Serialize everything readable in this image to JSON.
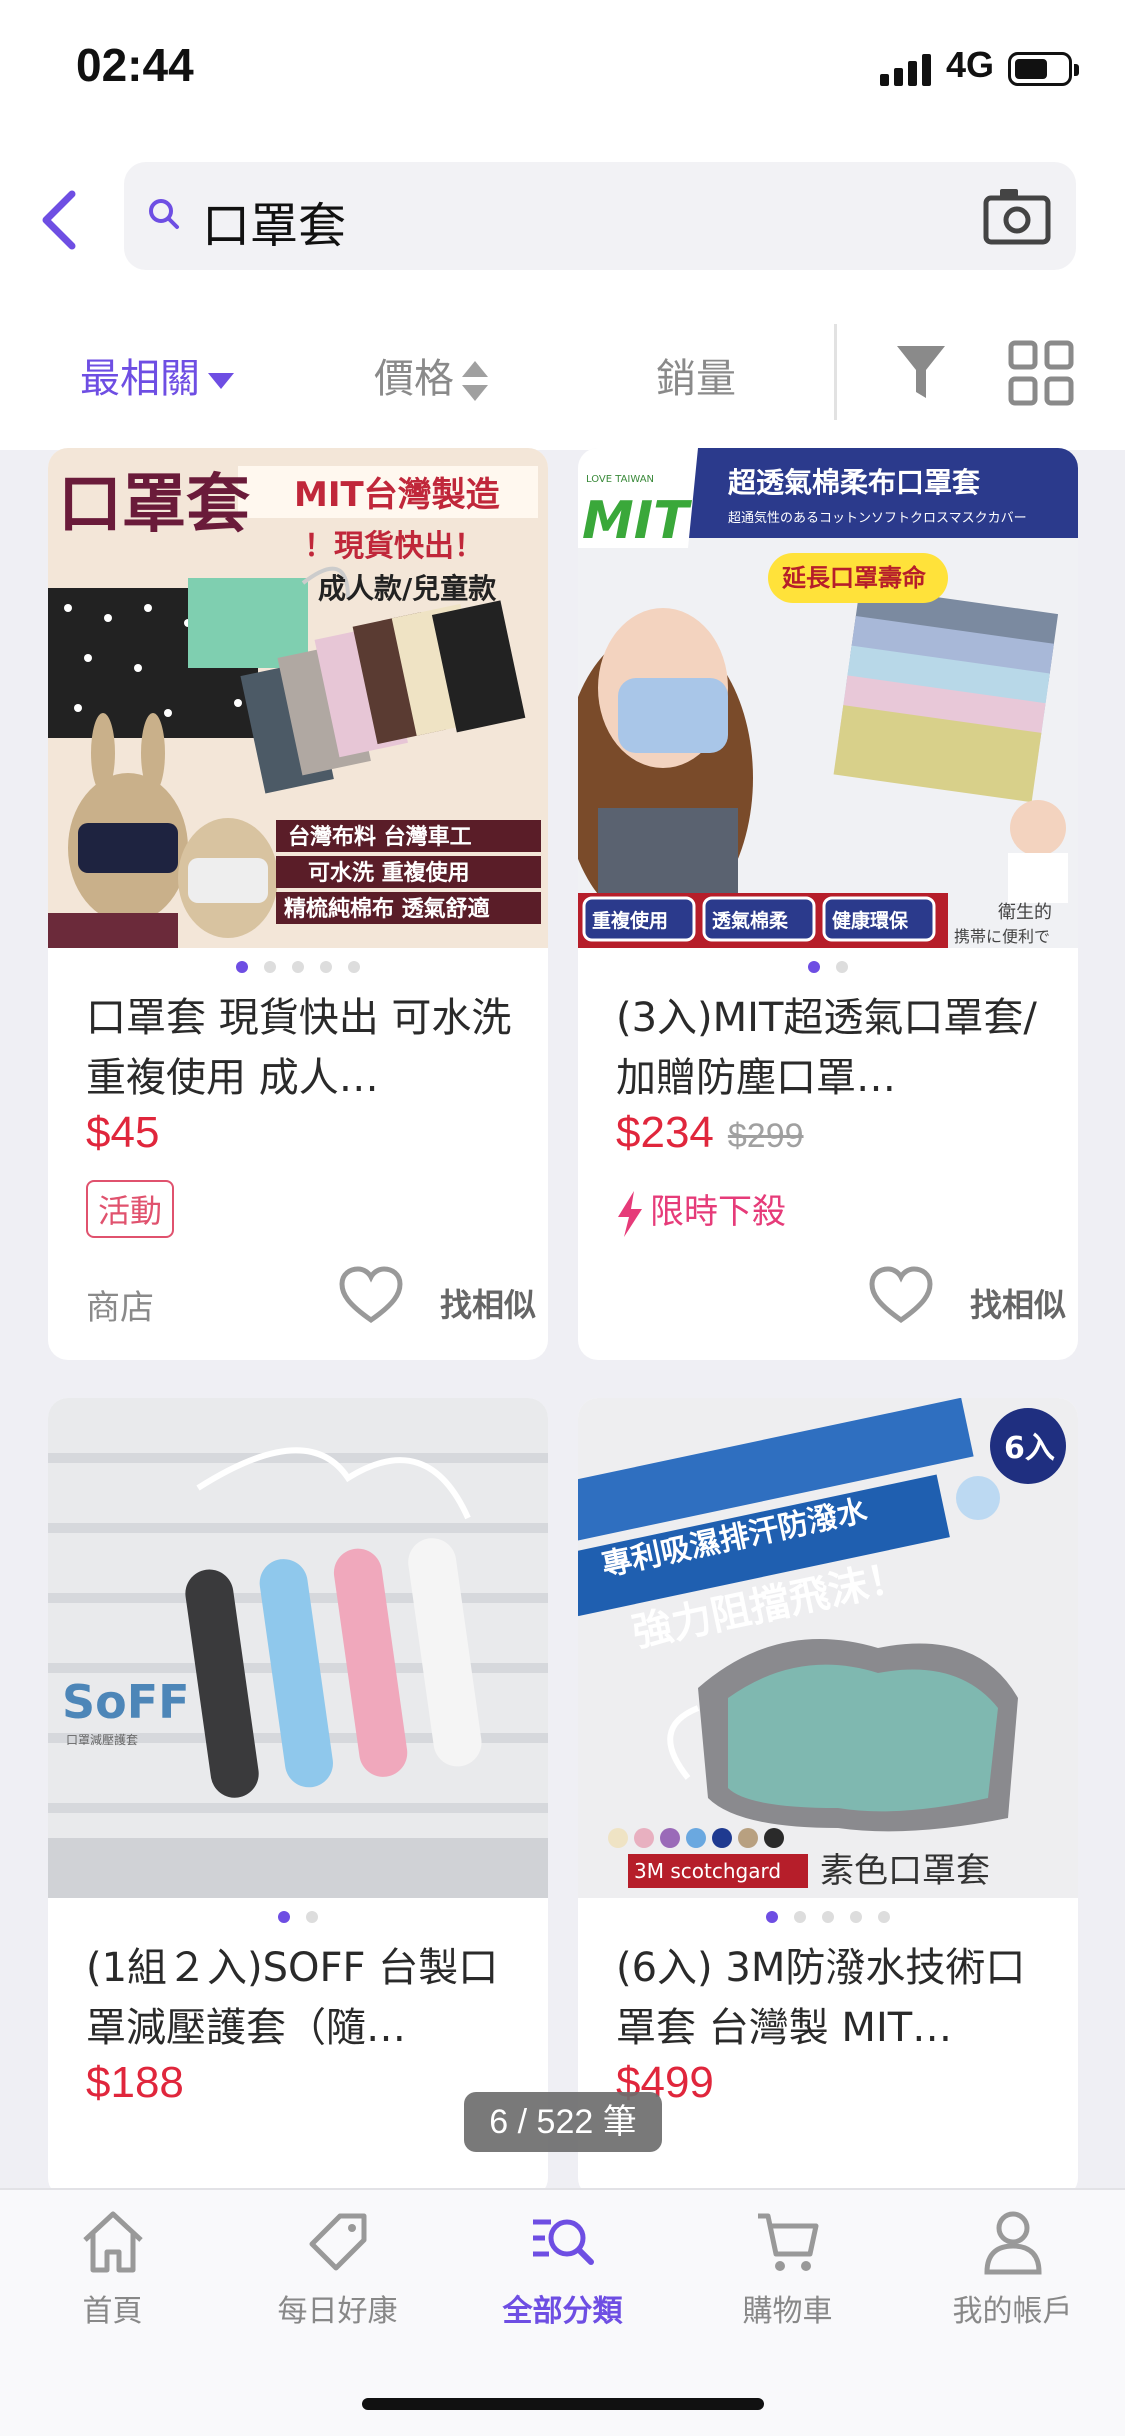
{
  "status_bar": {
    "time": "02:44",
    "network": "4G"
  },
  "search": {
    "query": "口罩套"
  },
  "sort": {
    "relevance": "最相關",
    "price": "價格",
    "sales": "銷量"
  },
  "products": [
    {
      "image_texts": [
        "口罩套",
        "MIT台灣製造",
        "！現貨快出！",
        "成人款/兒童款",
        "台灣布料 台灣車工",
        "可水洗 重複使用",
        "精梳純棉布 透氣舒適"
      ],
      "title": "口罩套 現貨快出 可水洗重複使用 成人…",
      "price": "$45",
      "tag": "活動",
      "store": "商店",
      "similar": "找相似"
    },
    {
      "image_texts": [
        "超透氣棉柔布口罩套",
        "超通気性のあるコットンソフトクロスマスクカバー",
        "LOVE TAIWAN",
        "MIT",
        "延長口罩壽命",
        "重複使用",
        "透氣棉柔",
        "健康環保",
        "衛生的",
        "携帯に便利で"
      ],
      "title": "(3入)MIT超透氣口罩套/加贈防塵口罩…",
      "price": "$234",
      "old_price": "$299",
      "flash": "限時下殺",
      "similar": "找相似"
    },
    {
      "image_texts": [
        "SoFF",
        "口罩減壓護套"
      ],
      "title": "(1組２入)SOFF 台製口罩減壓護套（隨…",
      "price": "$188"
    },
    {
      "image_texts": [
        "專利吸濕排汗防潑水",
        "強力阻擋飛沫！",
        "6入",
        "3M scotchgard",
        "素色口罩套"
      ],
      "title": "(6入) 3M防潑水技術口罩套 台灣製 MIT…",
      "price": "$499"
    }
  ],
  "counter": "6 / 522 筆",
  "tabs": [
    "首頁",
    "每日好康",
    "全部分類",
    "購物車",
    "我的帳戶"
  ],
  "colors": {
    "accent": "#6e4ee3",
    "price": "#e0263c",
    "flash": "#e63b79"
  }
}
